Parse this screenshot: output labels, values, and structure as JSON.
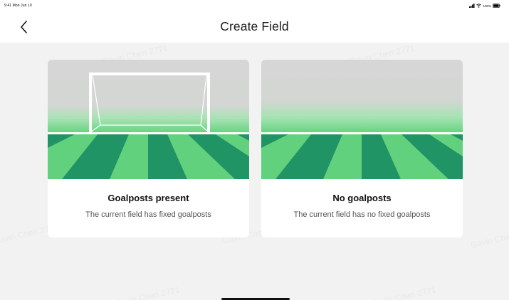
{
  "status_bar": {
    "time_date": "9:41 Mon Jun 10",
    "battery": "100%"
  },
  "header": {
    "title": "Create Field",
    "back_icon": "chevron-left-icon"
  },
  "cards": [
    {
      "title": "Goalposts present",
      "description": "The current field has fixed goalposts",
      "image": "field-with-goal"
    },
    {
      "title": "No goalposts",
      "description": "The current field has no fixed goalposts",
      "image": "field-without-goal"
    }
  ],
  "watermark": "Gavin Chen 2771",
  "colors": {
    "grass_light": "#62d17e",
    "grass_dark": "#219465",
    "sky": "#d6d6d6",
    "background": "#f2f2f2"
  }
}
